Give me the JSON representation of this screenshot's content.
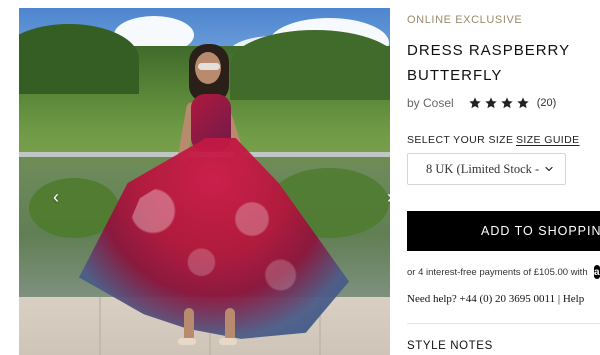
{
  "product": {
    "badge": "ONLINE EXCLUSIVE",
    "title_line1": "DRESS RASPBERRY",
    "title_line2": "BUTTERFLY",
    "brand": "by Cosel",
    "rating": {
      "stars_filled": 4,
      "stars_total": 4,
      "count_label": "(20)"
    }
  },
  "size": {
    "label": "SELECT YOUR SIZE",
    "guide_label": "SIZE GUIDE",
    "selected_value": "8 UK (Limited Stock -"
  },
  "actions": {
    "add_label": "ADD TO SHOPPING"
  },
  "payments": {
    "text": "or 4 interest-free payments of £105.00 with",
    "logo_label": "a"
  },
  "help": {
    "text": "Need help? +44 (0) 20 3695 0011 | Help"
  },
  "sections": {
    "style_notes_label": "STYLE NOTES"
  },
  "icons": {
    "prev": "chevron-left-icon",
    "next": "chevron-right-icon",
    "select": "chevron-down-icon",
    "star": "star-icon"
  }
}
